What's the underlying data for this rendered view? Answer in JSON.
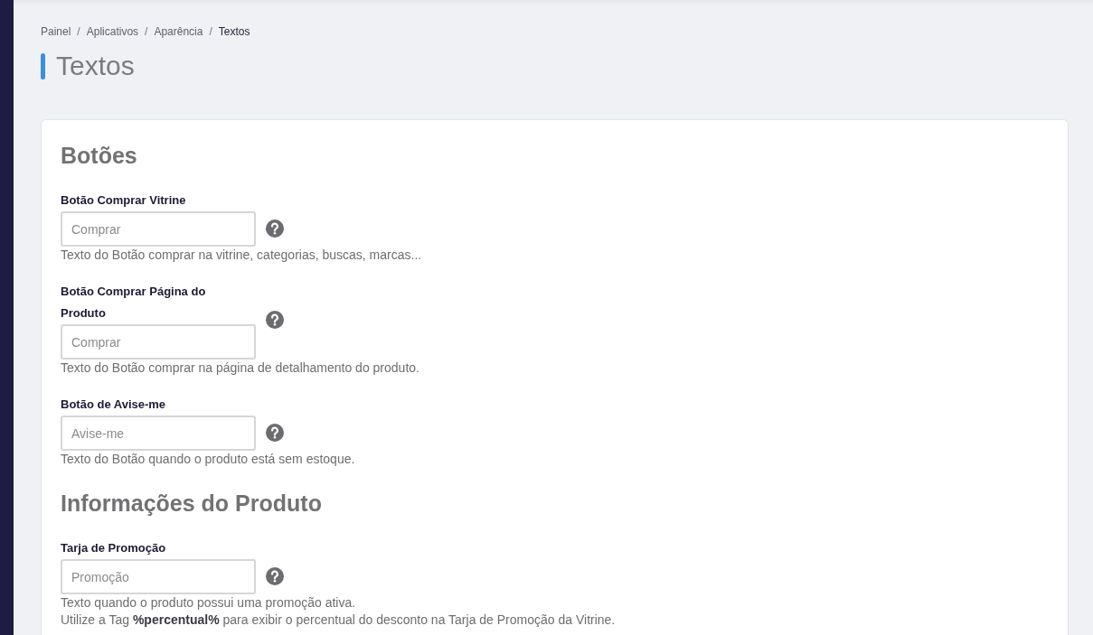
{
  "breadcrumb": {
    "separator": "/",
    "items": [
      {
        "label": "Painel",
        "current": false
      },
      {
        "label": "Aplicativos",
        "current": false
      },
      {
        "label": "Aparência",
        "current": false
      },
      {
        "label": "Textos",
        "current": true
      }
    ]
  },
  "page_title": "Textos",
  "sections": [
    {
      "title": "Botões",
      "fields": [
        {
          "label": "Botão Comprar Vitrine",
          "placeholder": "Comprar",
          "help": [
            "Texto do Botão comprar na vitrine, categorias, buscas, marcas..."
          ]
        },
        {
          "label": "Botão Comprar Página do Produto",
          "placeholder": "Comprar",
          "help": [
            "Texto do Botão comprar na página de detalhamento do produto."
          ]
        },
        {
          "label": "Botão de Avise-me",
          "placeholder": "Avise-me",
          "help": [
            "Texto do Botão quando o produto está sem estoque."
          ]
        }
      ]
    },
    {
      "title": "Informações do Produto",
      "fields": [
        {
          "label": "Tarja de Promoção",
          "placeholder": "Promoção",
          "help": [
            "Texto quando o produto possui uma promoção ativa.",
            "Utilize a Tag **%percentual%** para exibir o percentual do desconto na Tarja de Promoção da Vitrine."
          ]
        }
      ]
    }
  ]
}
